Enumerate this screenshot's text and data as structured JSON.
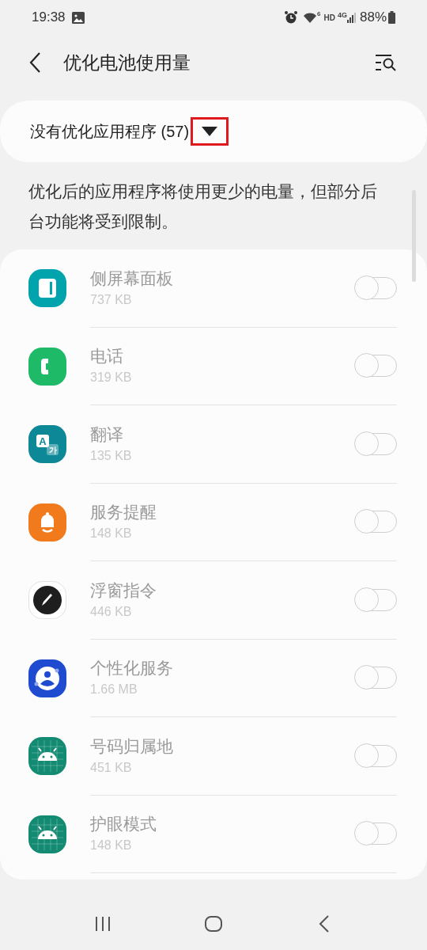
{
  "status_bar": {
    "time": "19:38",
    "wifi_badge": "6",
    "hd": "HD",
    "network": "4G",
    "battery": "88%"
  },
  "header": {
    "title": "优化电池使用量"
  },
  "filter": {
    "label": "没有优化应用程序 (57)",
    "highlighted": true
  },
  "description": "优化后的应用程序将使用更少的电量，但部分后台功能将受到限制。",
  "apps": [
    {
      "name": "侧屏幕面板",
      "size": "737 KB",
      "kind": "panel",
      "color": "#01a4ad",
      "disabled": true,
      "on": false
    },
    {
      "name": "电话",
      "size": "319 KB",
      "kind": "phone",
      "color": "#1eba67",
      "disabled": true,
      "on": false
    },
    {
      "name": "翻译",
      "size": "135 KB",
      "kind": "translate",
      "color": "#0d8896",
      "badge_letters": [
        "A",
        "가"
      ],
      "disabled": true,
      "on": false
    },
    {
      "name": "服务提醒",
      "size": "148 KB",
      "kind": "bell",
      "color": "#f07a1c",
      "disabled": true,
      "on": false
    },
    {
      "name": "浮窗指令",
      "size": "446 KB",
      "kind": "pen",
      "color": "#1e1e1e",
      "disabled": true,
      "on": false
    },
    {
      "name": "个性化服务",
      "size": "1.66 MB",
      "kind": "person",
      "color": "#1f4bd1",
      "disabled": true,
      "on": false
    },
    {
      "name": "号码归属地",
      "size": "451 KB",
      "kind": "android",
      "color": "#138a72",
      "disabled": true,
      "on": false
    },
    {
      "name": "护眼模式",
      "size": "148 KB",
      "kind": "android",
      "color": "#138a72",
      "disabled": true,
      "on": false
    }
  ]
}
